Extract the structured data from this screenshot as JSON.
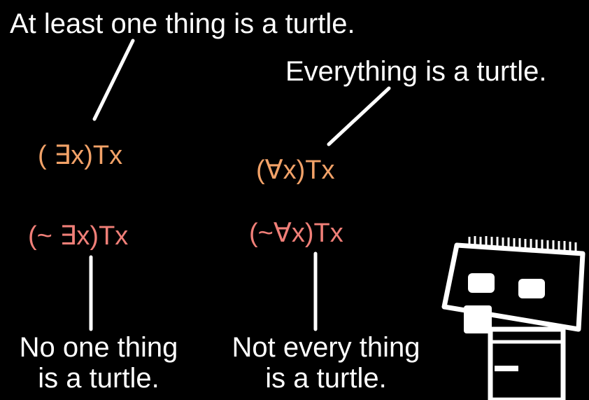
{
  "captions": {
    "exists": "At least one thing is a turtle.",
    "forall": "Everything is a turtle.",
    "not_exists_line1": "No one thing",
    "not_exists_line2": "is a turtle.",
    "not_forall_line1": "Not every thing",
    "not_forall_line2": "is a turtle."
  },
  "formulas": {
    "exists": "( ∃x)Tx",
    "forall": "(∀x)Tx",
    "not_exists": "(~ ∃x)Tx",
    "not_forall": "(~∀x)Tx"
  },
  "colors": {
    "background": "#000000",
    "caption": "#ffffff",
    "formula_positive": "#f2a268",
    "formula_negated": "#f07f78"
  },
  "icons": {
    "character": "robot-character-icon"
  }
}
